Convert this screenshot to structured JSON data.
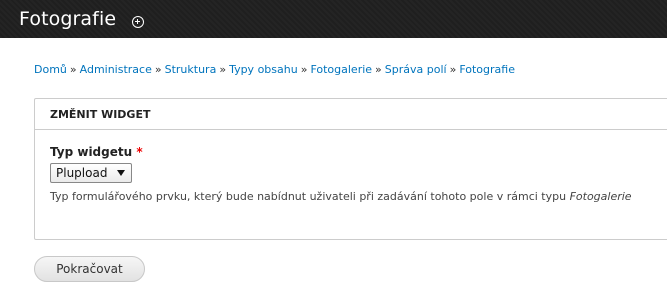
{
  "header": {
    "title": "Fotografie",
    "shortcut_icon": "add-shortcut-icon"
  },
  "breadcrumb": {
    "items": [
      "Domů",
      "Administrace",
      "Struktura",
      "Typy obsahu",
      "Fotogalerie",
      "Správa polí",
      "Fotografie"
    ],
    "separator": "»"
  },
  "form": {
    "fieldset_title": "ZMĚNIT WIDGET",
    "field_label": "Typ widgetu",
    "required_marker": "*",
    "select_value": "Plupload",
    "description_prefix": "Typ formulářového prvku, který bude nabídnut uživateli při zadávání tohoto pole v rámci typu",
    "description_type": "Fotogalerie",
    "submit_label": "Pokračovat"
  },
  "colors": {
    "header_bg": "#1f1f1f",
    "link": "#0074bd",
    "required": "#ee0000"
  }
}
